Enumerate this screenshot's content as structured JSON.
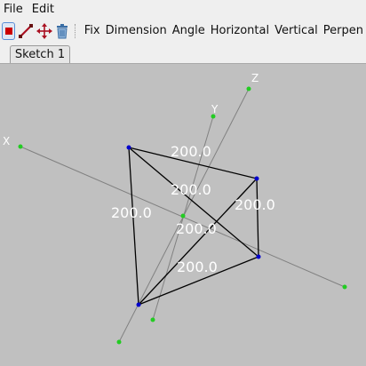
{
  "menubar": {
    "file": "File",
    "edit": "Edit"
  },
  "toolbar": {
    "fix": "Fix",
    "dimension": "Dimension",
    "angle": "Angle",
    "horizontal": "Horizontal",
    "vertical": "Vertical",
    "perpendicular": "Perpen"
  },
  "tabs": [
    {
      "label": "Sketch 1"
    }
  ],
  "axes": {
    "x": "X",
    "y": "Y",
    "z": "Z"
  },
  "dimensions": [
    "200.0",
    "200.0",
    "200.0",
    "200.0",
    "200.0",
    "200.0"
  ],
  "colors": {
    "background": "#c0c0c0",
    "axis_line": "#808080",
    "axis_point": "#22cc22",
    "edge": "#000000",
    "vertex": "#0000cc",
    "dimension_text": "#ffffff",
    "stop_icon": "#cc0000",
    "line_tool_icon": "#aa1122"
  },
  "icons": {
    "stop": "stop-square-icon",
    "line": "line-tool-icon",
    "move": "move-arrows-icon",
    "delete": "trash-icon"
  }
}
